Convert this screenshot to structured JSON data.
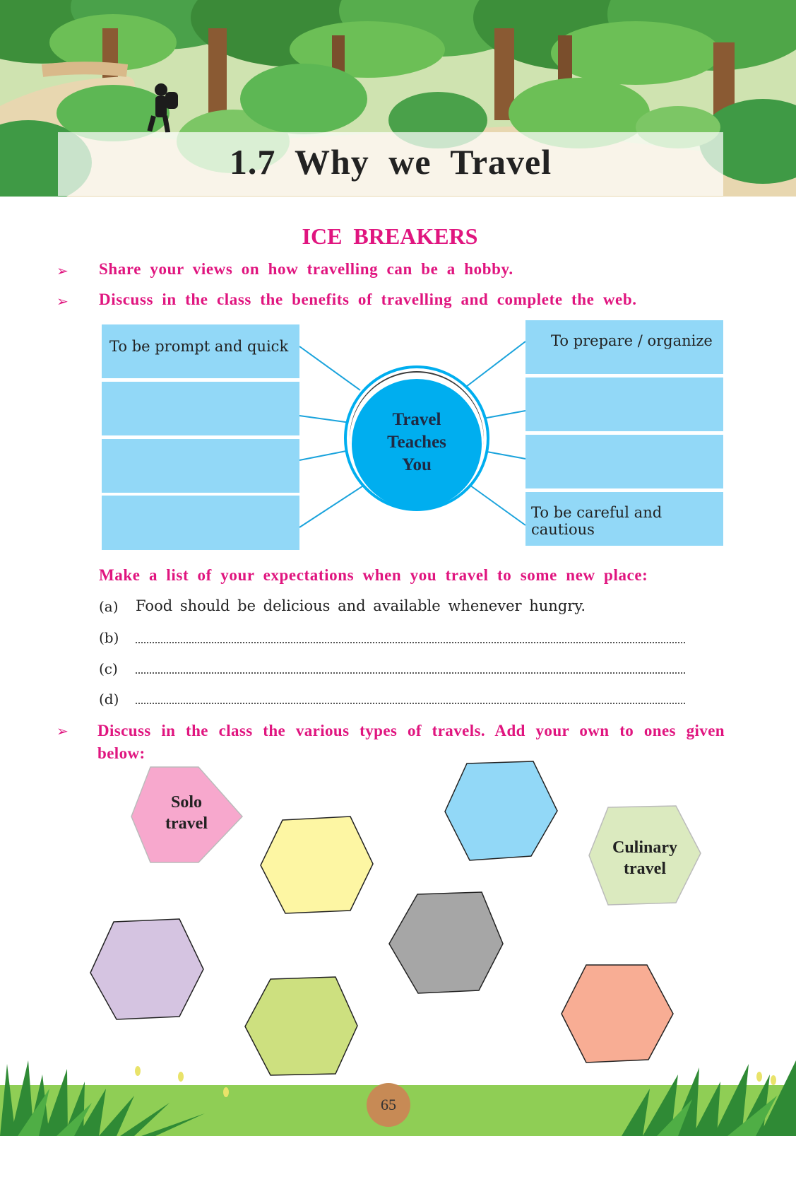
{
  "page": {
    "title": "1.7  Why  we  Travel",
    "page_number": "65"
  },
  "ice_breakers": {
    "heading": "ICE  BREAKERS",
    "bullets": [
      "Share your views on how travelling can be a hobby.",
      "Discuss in the class the benefits of travelling and complete the web."
    ]
  },
  "web": {
    "center": [
      "Travel",
      "Teaches",
      "You"
    ],
    "left_boxes": [
      "To be prompt and quick",
      "",
      "",
      ""
    ],
    "right_boxes": [
      "To prepare / organize",
      "",
      "",
      "To be careful and cautious"
    ]
  },
  "expectations": {
    "prompt": "Make a list of your expectations when you  travel to some new place:",
    "items": [
      {
        "label": "(a)",
        "text": "Food should be delicious and available whenever hungry."
      },
      {
        "label": "(b)",
        "text": ""
      },
      {
        "label": "(c)",
        "text": ""
      },
      {
        "label": "(d)",
        "text": ""
      }
    ]
  },
  "travel_types": {
    "prompt": "Discuss in the class the various types of travels. Add your own to ones given below:",
    "shapes": [
      {
        "lines": [
          "Solo",
          "travel"
        ],
        "color": "#f7a8cd"
      },
      {
        "lines": [],
        "color": "#fdf6a3"
      },
      {
        "lines": [],
        "color": "#92d8f7"
      },
      {
        "lines": [
          "Culinary",
          "travel"
        ],
        "color": "#dbeabf"
      },
      {
        "lines": [],
        "color": "#d5c4e1"
      },
      {
        "lines": [],
        "color": "#a6a6a6"
      },
      {
        "lines": [],
        "color": "#cde07f"
      },
      {
        "lines": [],
        "color": "#f8ad94"
      }
    ]
  },
  "colors": {
    "heading_pink": "#e0157f",
    "box_blue": "#92d8f7",
    "hub_blue": "#00aeef",
    "footer_green": "#8fce55"
  }
}
